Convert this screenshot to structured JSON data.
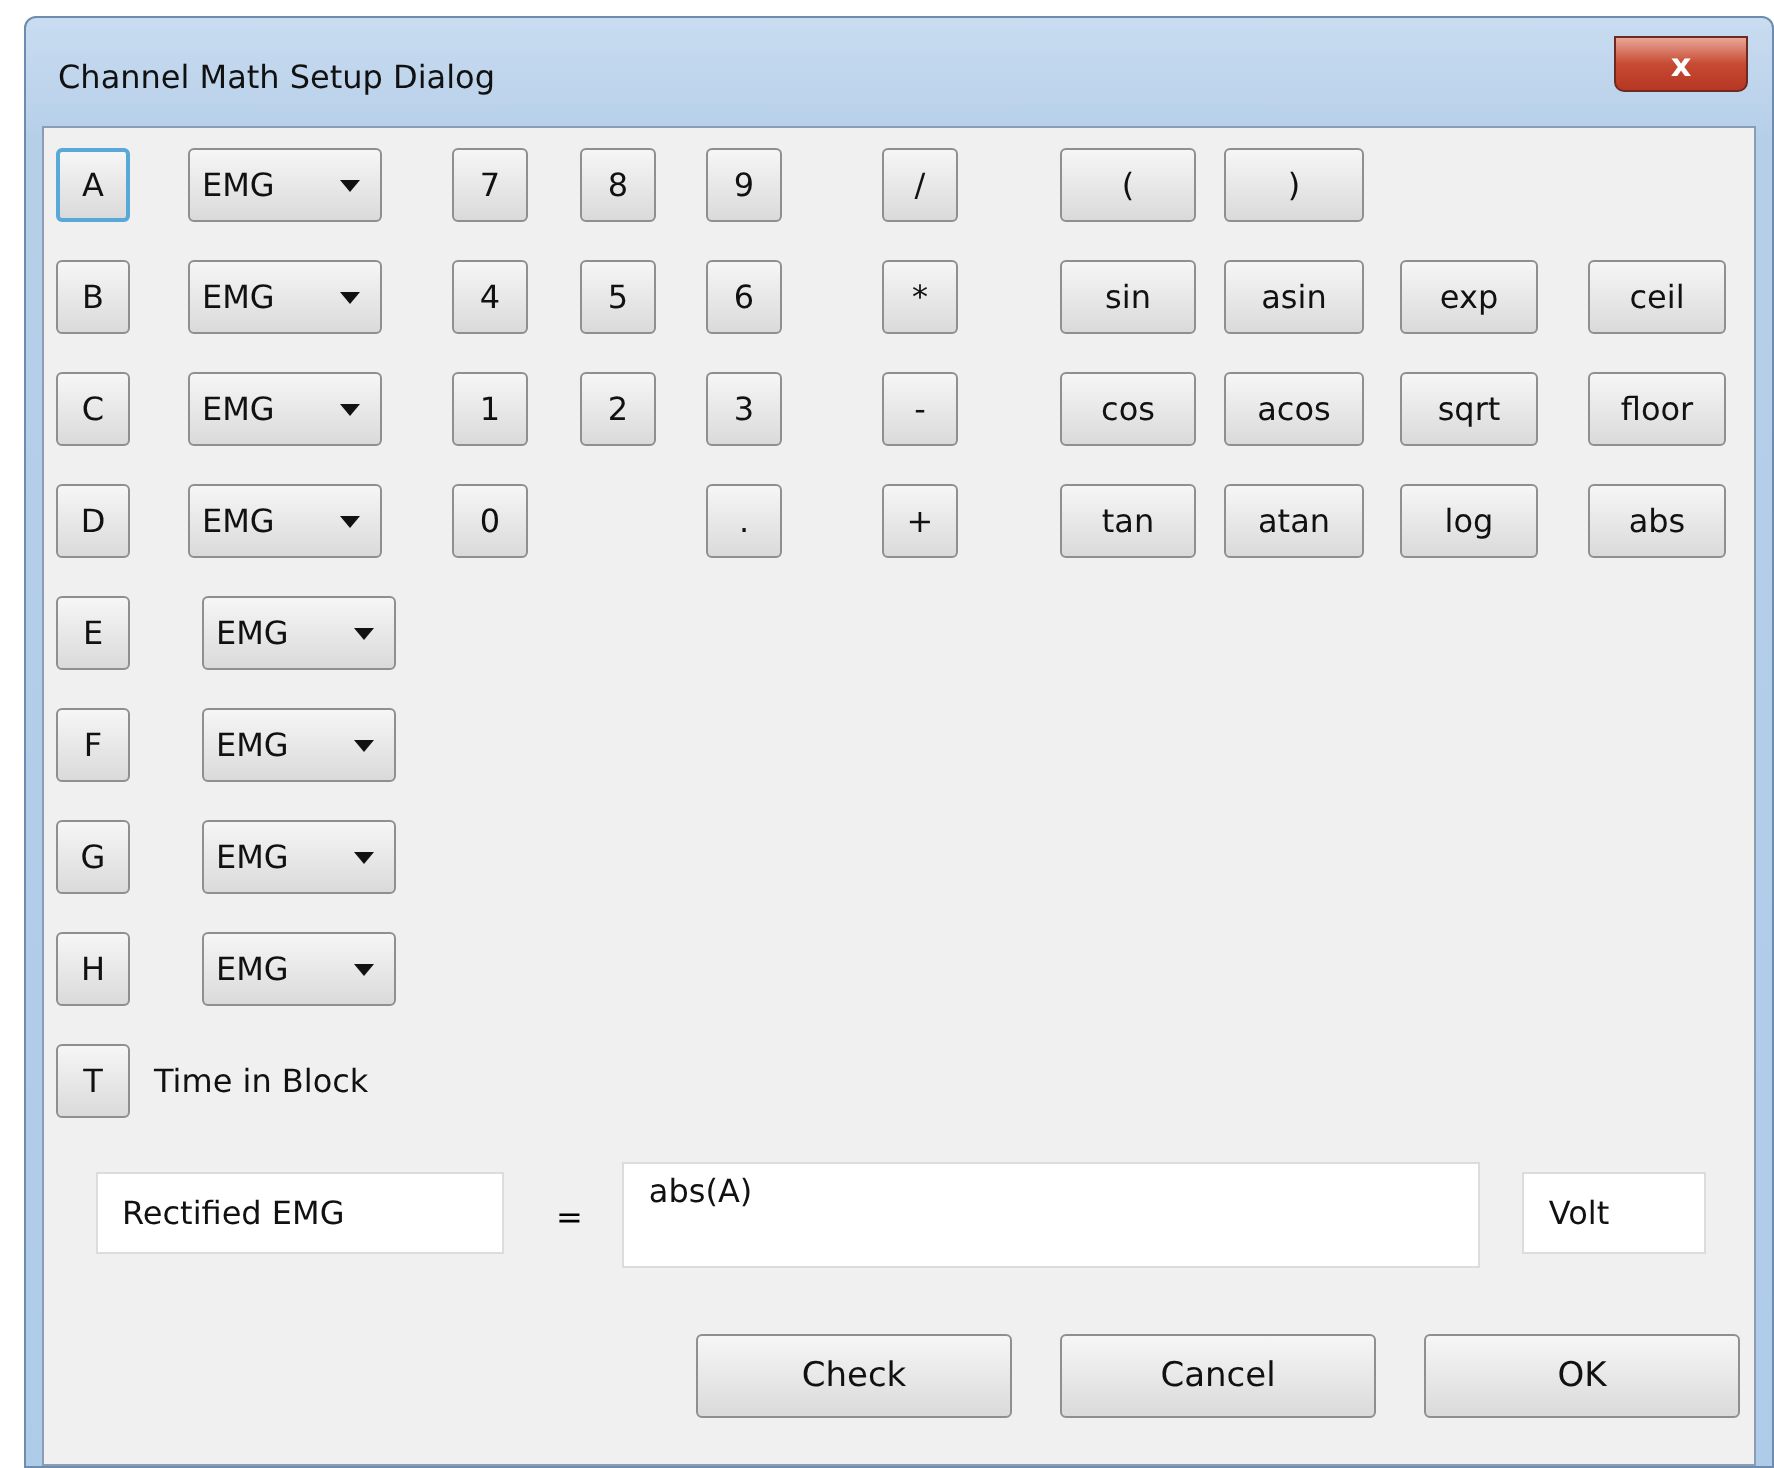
{
  "window": {
    "title": "Channel Math Setup Dialog",
    "close_label": "x"
  },
  "channels": [
    {
      "key": "A",
      "source": "EMG",
      "focused": true
    },
    {
      "key": "B",
      "source": "EMG",
      "focused": false
    },
    {
      "key": "C",
      "source": "EMG",
      "focused": false
    },
    {
      "key": "D",
      "source": "EMG",
      "focused": false
    },
    {
      "key": "E",
      "source": "EMG",
      "focused": false
    },
    {
      "key": "F",
      "source": "EMG",
      "focused": false
    },
    {
      "key": "G",
      "source": "EMG",
      "focused": false
    },
    {
      "key": "H",
      "source": "EMG",
      "focused": false
    }
  ],
  "time_channel": {
    "key": "T",
    "label": "Time in Block"
  },
  "digit_rows": [
    [
      "7",
      "8",
      "9"
    ],
    [
      "4",
      "5",
      "6"
    ],
    [
      "1",
      "2",
      "3"
    ],
    [
      "0",
      null,
      "."
    ]
  ],
  "operators": [
    "/",
    "*",
    "-",
    "+"
  ],
  "function_rows": [
    [
      "(",
      ")",
      null,
      null
    ],
    [
      "sin",
      "asin",
      "exp",
      "ceil"
    ],
    [
      "cos",
      "acos",
      "sqrt",
      "floor"
    ],
    [
      "tan",
      "atan",
      "log",
      "abs"
    ]
  ],
  "formula": {
    "name": "Rectified EMG",
    "equals": "=",
    "expression": "abs(A)",
    "unit": "Volt"
  },
  "buttons": [
    "Check",
    "Cancel",
    "OK"
  ]
}
